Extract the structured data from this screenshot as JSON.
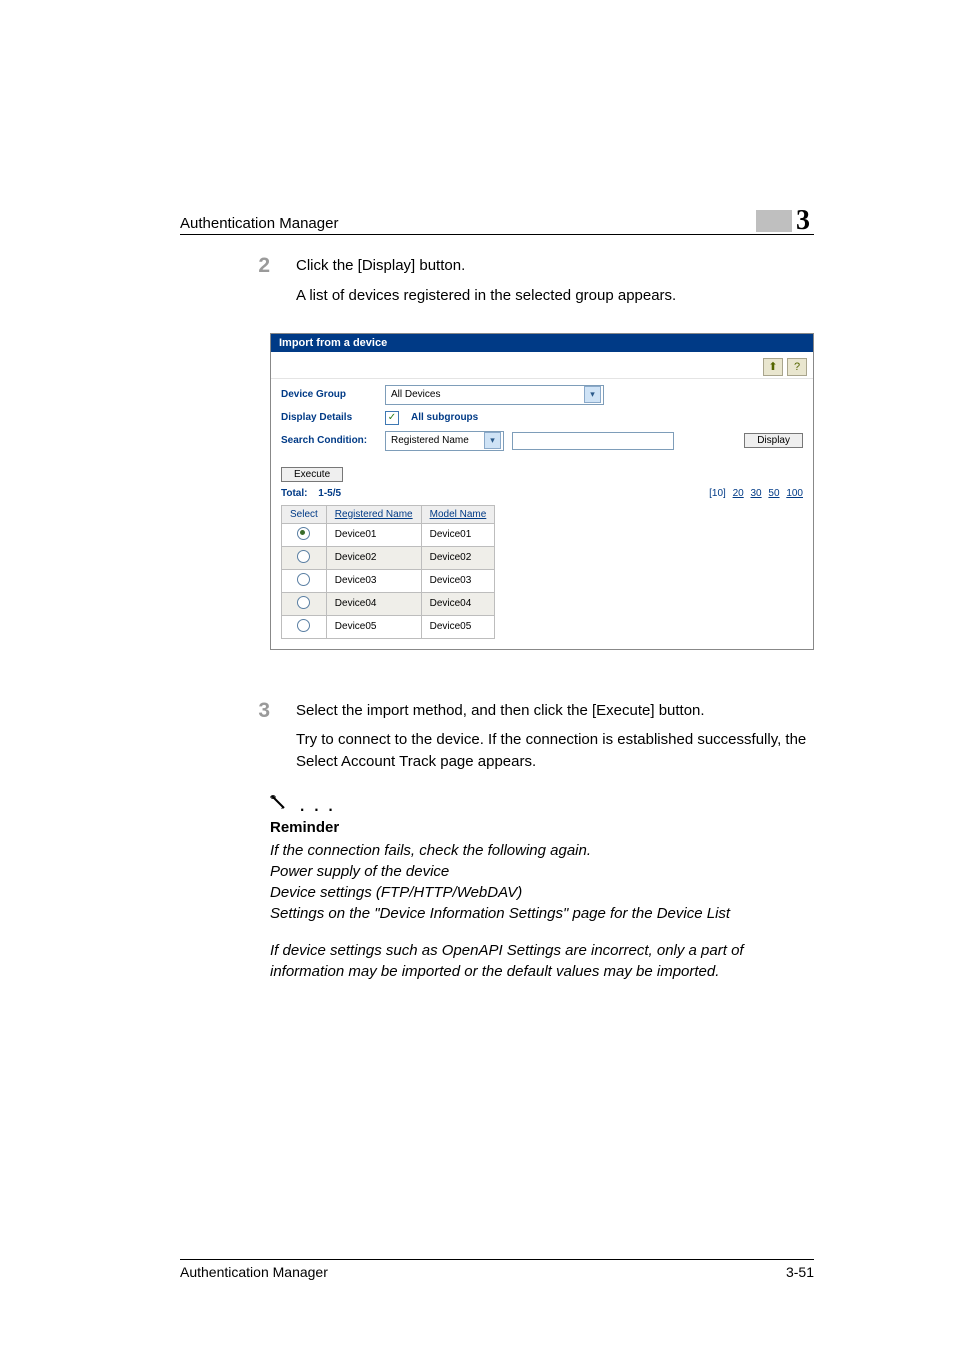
{
  "header": {
    "title": "Authentication Manager",
    "chapter": "3"
  },
  "steps": {
    "s2": {
      "num": "2",
      "line1": "Click the [Display] button.",
      "line2": "A list of devices registered in the selected group appears."
    },
    "s3": {
      "num": "3",
      "line1": "Select the import method, and then click the [Execute] button.",
      "line2": "Try to connect to the device. If the connection is established successfully, the Select Account Track page appears."
    }
  },
  "ui": {
    "title": "Import from a device",
    "icons": {
      "up": "⬆",
      "help": "?"
    },
    "filters": {
      "deviceGroupLabel": "Device Group",
      "deviceGroupValue": "All Devices",
      "displayDetailsLabel": "Display Details",
      "allSubgroups": "All subgroups",
      "searchConditionLabel": "Search Condition:",
      "searchConditionValue": "Registered Name",
      "displayBtn": "Display"
    },
    "executeBtn": "Execute",
    "totalLabel": "Total:",
    "totalValue": "1-5/5",
    "pager": {
      "current": "[10]",
      "p20": "20",
      "p30": "30",
      "p50": "50",
      "p100": "100"
    },
    "columns": {
      "select": "Select",
      "regName": "Registered Name",
      "model": "Model Name"
    },
    "rows": [
      {
        "selected": true,
        "reg": "Device01",
        "model": "Device01"
      },
      {
        "selected": false,
        "reg": "Device02",
        "model": "Device02"
      },
      {
        "selected": false,
        "reg": "Device03",
        "model": "Device03"
      },
      {
        "selected": false,
        "reg": "Device04",
        "model": "Device04"
      },
      {
        "selected": false,
        "reg": "Device05",
        "model": "Device05"
      }
    ]
  },
  "reminder": {
    "head": "Reminder",
    "l1": "If the connection fails, check the following again.",
    "l2": "Power supply of the device",
    "l3": "Device settings (FTP/HTTP/WebDAV)",
    "l4": "Settings on the \"Device Information Settings\" page for the Device List",
    "l5": "If device settings such as OpenAPI Settings are incorrect, only a part of information may be imported or the default values may be imported."
  },
  "footer": {
    "left": "Authentication Manager",
    "right": "3-51"
  }
}
